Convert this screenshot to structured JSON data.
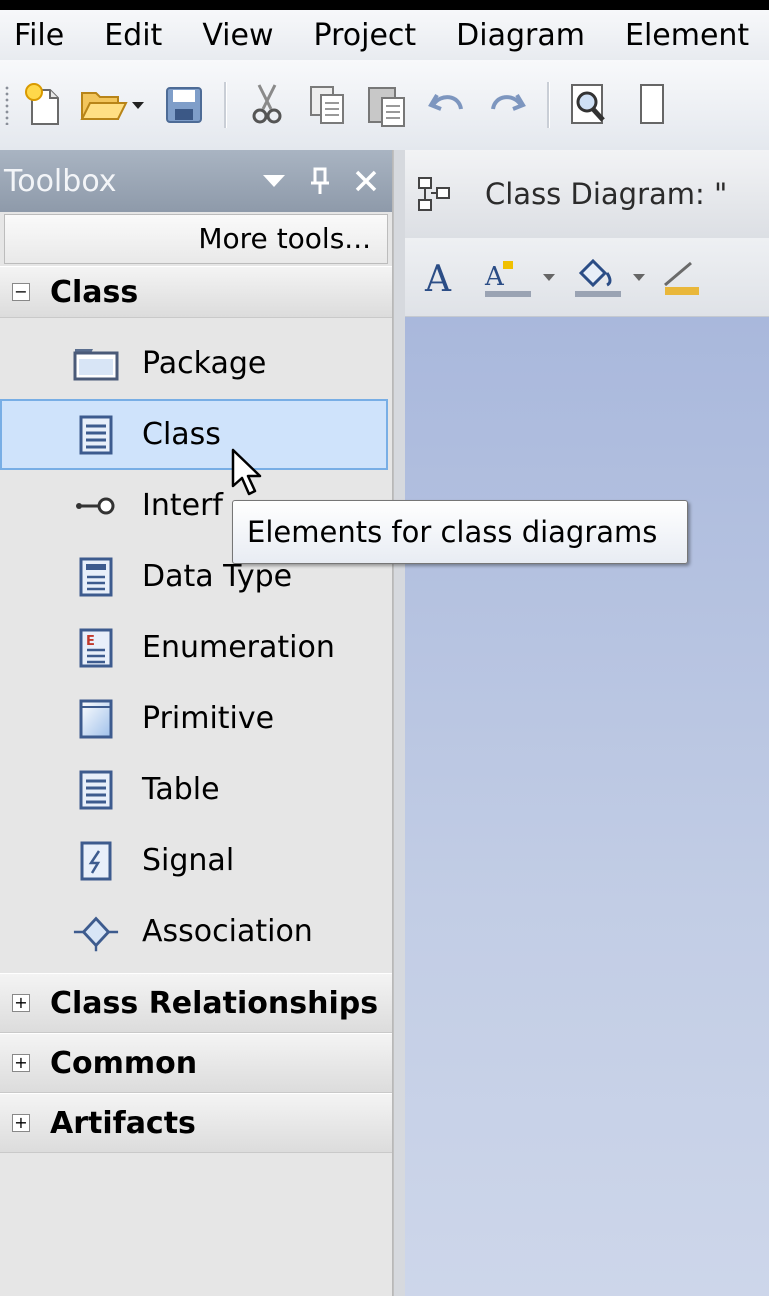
{
  "menu": {
    "items": [
      "File",
      "Edit",
      "View",
      "Project",
      "Diagram",
      "Element"
    ]
  },
  "toolbar": {
    "icons": [
      "new-file-icon",
      "open-folder-icon",
      "save-icon",
      "cut-icon",
      "copy-icon",
      "paste-icon",
      "undo-icon",
      "redo-icon",
      "find-icon",
      "page-icon"
    ]
  },
  "toolbox": {
    "title": "Toolbox",
    "more_tools": "More tools...",
    "sections": [
      {
        "label": "Class",
        "expanded": true,
        "expander": "−",
        "items": [
          {
            "label": "Package",
            "icon": "package-icon"
          },
          {
            "label": "Class",
            "icon": "class-icon",
            "selected": true
          },
          {
            "label": "Interf",
            "icon": "interface-icon"
          },
          {
            "label": "Data Type",
            "icon": "data-type-icon"
          },
          {
            "label": "Enumeration",
            "icon": "enumeration-icon"
          },
          {
            "label": "Primitive",
            "icon": "primitive-icon"
          },
          {
            "label": "Table",
            "icon": "table-icon"
          },
          {
            "label": "Signal",
            "icon": "signal-icon"
          },
          {
            "label": "Association",
            "icon": "association-icon"
          }
        ]
      },
      {
        "label": "Class Relationships",
        "expanded": false,
        "expander": "+"
      },
      {
        "label": "Common",
        "expanded": false,
        "expander": "+"
      },
      {
        "label": "Artifacts",
        "expanded": false,
        "expander": "+"
      }
    ]
  },
  "diagram": {
    "tab_title": "Class Diagram: \""
  },
  "tooltip": {
    "text": "Elements for class diagrams"
  },
  "colors": {
    "selection": "#cfe3fb",
    "selection_border": "#78aee5",
    "canvas_top": "#a9b8dc",
    "header": "#9aa6b6"
  }
}
